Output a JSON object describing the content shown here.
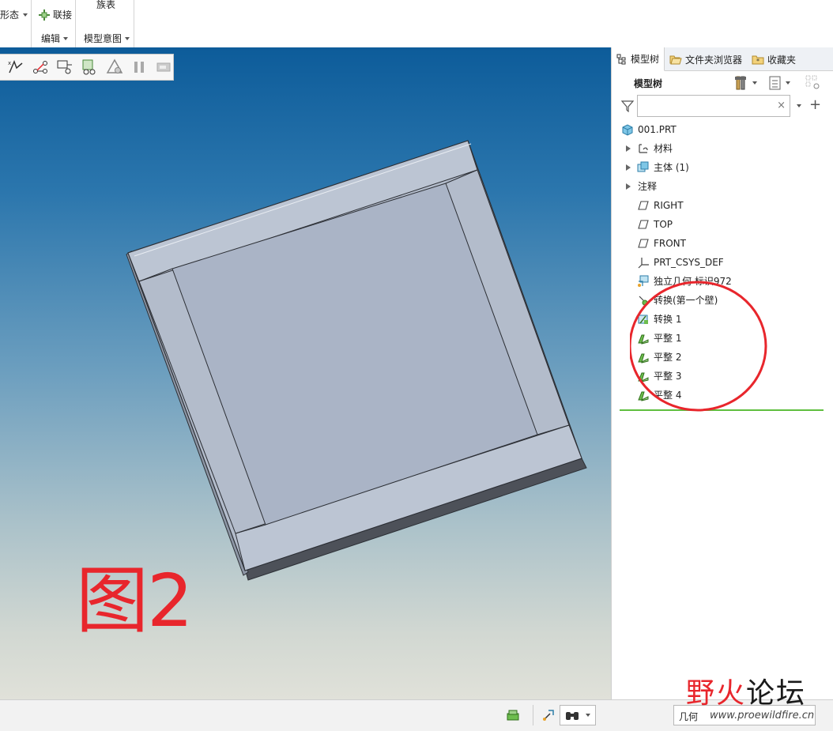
{
  "ribbon": {
    "partial_button_label": "形态",
    "connect_label": "联接",
    "family_table_label": "族表",
    "edit_group_label": "编辑",
    "model_intent_group_label": "模型意图"
  },
  "viewport": {
    "figure_label": "图2"
  },
  "side_panel": {
    "tabs": [
      {
        "label": "模型树",
        "icon": "model-tree-icon"
      },
      {
        "label": "文件夹浏览器",
        "icon": "folder-browser-icon"
      },
      {
        "label": "收藏夹",
        "icon": "favorites-icon"
      }
    ],
    "tree_title": "模型树",
    "search": {
      "value": "",
      "placeholder": ""
    },
    "tree": [
      {
        "label": "001.PRT",
        "icon": "part-icon",
        "expandable": false,
        "root": true
      },
      {
        "label": "材料",
        "icon": "material-icon",
        "expandable": true
      },
      {
        "label": "主体 (1)",
        "icon": "body-icon",
        "expandable": true
      },
      {
        "label": "注释",
        "icon": "",
        "expandable": true
      },
      {
        "label": "RIGHT",
        "icon": "datum-plane-icon",
        "expandable": false
      },
      {
        "label": "TOP",
        "icon": "datum-plane-icon",
        "expandable": false
      },
      {
        "label": "FRONT",
        "icon": "datum-plane-icon",
        "expandable": false
      },
      {
        "label": "PRT_CSYS_DEF",
        "icon": "coordinate-system-icon",
        "expandable": false
      },
      {
        "label": "独立几何 标识972",
        "icon": "independent-geometry-icon",
        "expandable": false
      },
      {
        "label": "转换(第一个壁)",
        "icon": "convert-wall-icon",
        "expandable": false
      },
      {
        "label": "转换 1",
        "icon": "convert-icon",
        "expandable": false
      },
      {
        "label": "平整 1",
        "icon": "flat-wall-icon",
        "expandable": false
      },
      {
        "label": "平整 2",
        "icon": "flat-wall-icon",
        "expandable": false
      },
      {
        "label": "平整 3",
        "icon": "flat-wall-icon",
        "expandable": false
      },
      {
        "label": "平整 4",
        "icon": "flat-wall-icon",
        "expandable": false
      }
    ]
  },
  "status_bar": {
    "selection_filter": "几何"
  },
  "watermark": {
    "title_red": "野火",
    "title_dark": "论坛",
    "url": "www.proewildfire.cn"
  },
  "colors": {
    "accent_red": "#e8262c",
    "insert_line": "#5fbf3f",
    "model_face": "#b0b9ca",
    "viewport_top": "#0d5c9a"
  }
}
